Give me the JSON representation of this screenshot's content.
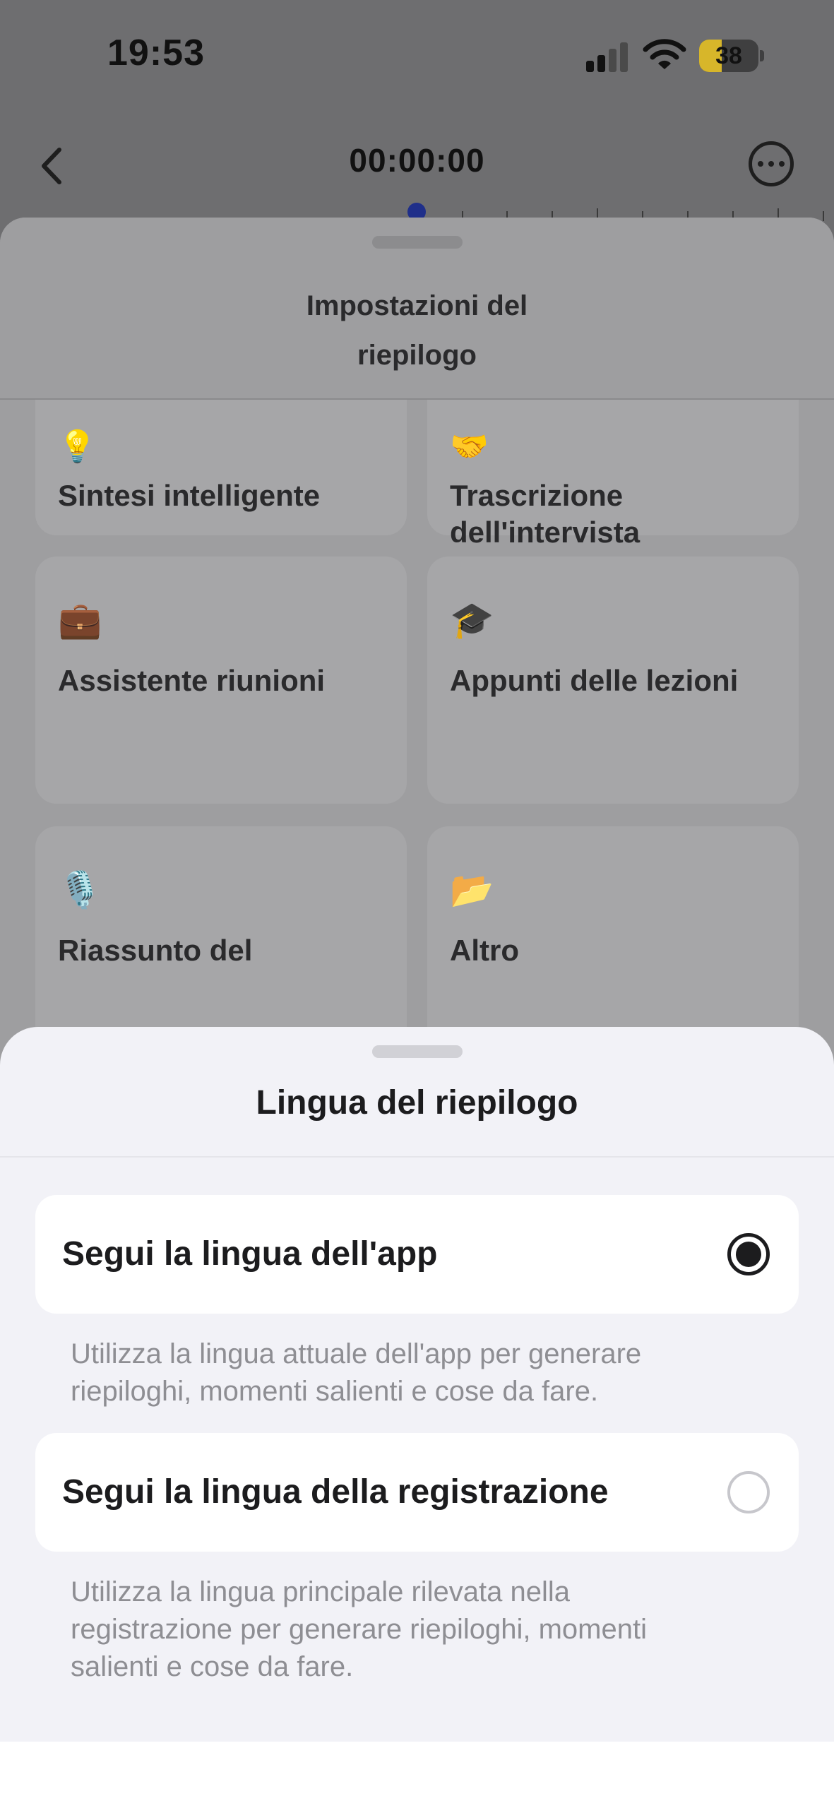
{
  "status_bar": {
    "time": "19:53",
    "battery_level": "38",
    "battery_fraction": 0.38,
    "signal_icon": "cellular-signal-icon",
    "wifi_icon": "wifi-icon"
  },
  "header": {
    "timer": "00:00:00",
    "back_icon": "chevron-left-icon",
    "more_icon": "ellipsis-circle-icon"
  },
  "summary_settings": {
    "title_line1": "Impostazioni del",
    "title_line2": "riepilogo",
    "cards": [
      {
        "icon": "💡",
        "label": "Sintesi intelligente"
      },
      {
        "icon": "🤝",
        "label": "Trascrizione dell'intervista"
      },
      {
        "icon": "💼",
        "label": "Assistente riunioni"
      },
      {
        "icon": "🎓",
        "label": "Appunti delle lezioni"
      },
      {
        "icon": "🎙️",
        "label": "Riassunto del"
      },
      {
        "icon": "📂",
        "label": "Altro"
      }
    ]
  },
  "language_sheet": {
    "title": "Lingua del riepilogo",
    "options": [
      {
        "label": "Segui la lingua dell'app",
        "selected": true,
        "description_line1": "Utilizza la lingua attuale dell'app per generare",
        "description_line2": "riepiloghi, momenti salienti e cose da fare."
      },
      {
        "label": "Segui la lingua della registrazione",
        "selected": false,
        "description_line1": "Utilizza la lingua principale rilevata nella",
        "description_line2": "registrazione per generare riepiloghi, momenti",
        "description_line3": "salienti e cose da fare."
      }
    ]
  },
  "colors": {
    "accent": "#1c1c1e",
    "timeline_knob": "#1f2f8a",
    "battery": "#d7b62a",
    "sheet_background": "#f2f2f7"
  }
}
